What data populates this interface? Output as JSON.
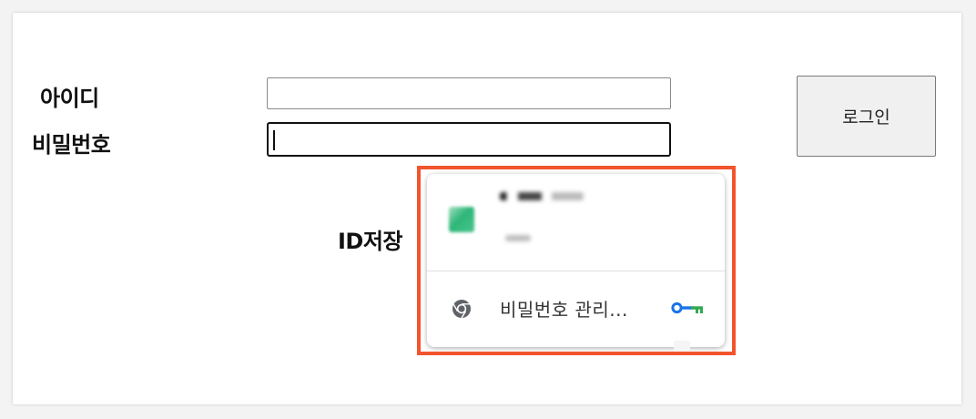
{
  "form": {
    "id_label": "아이디",
    "password_label": "비밀번호",
    "id_value": "",
    "password_value": "",
    "save_id_label": "ID저장",
    "login_button": "로그인"
  },
  "autofill_popup": {
    "suggestion_icon": "site-favicon (blurred)",
    "manage_label": "비밀번호 관리...",
    "manage_icon": "chrome-icon",
    "key_icon": "key-icon"
  },
  "colors": {
    "highlight": "#f2542d",
    "key_blue": "#1a73e8",
    "key_green": "#34a853"
  }
}
